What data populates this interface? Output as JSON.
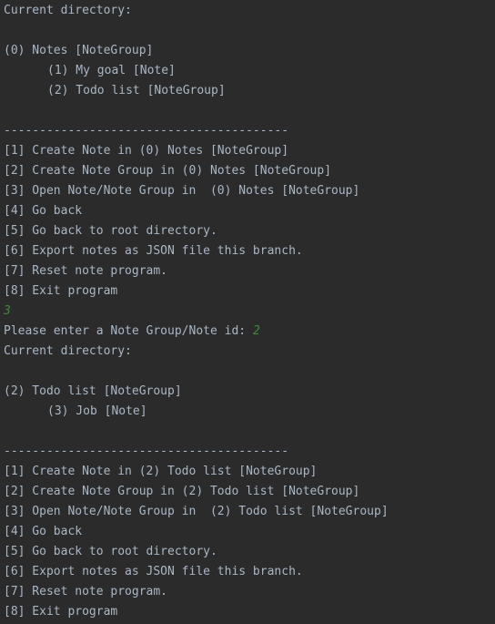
{
  "colors": {
    "background": "#2b2b2b",
    "text": "#a9b7c6",
    "user_input": "#3c8c3c"
  },
  "block1": {
    "header": "Current directory:",
    "dir": "(0) Notes [NoteGroup]",
    "children": [
      "(1) My goal [Note]",
      "(2) Todo list [NoteGroup]"
    ],
    "separator": "----------------------------------------",
    "menu": [
      "[1] Create Note in (0) Notes [NoteGroup]",
      "[2] Create Note Group in (0) Notes [NoteGroup]",
      "[3] Open Note/Note Group in  (0) Notes [NoteGroup]",
      "[4] Go back",
      "[5] Go back to root directory.",
      "[6] Export notes as JSON file this branch.",
      "[7] Reset note program.",
      "[8] Exit program"
    ],
    "input": "3"
  },
  "prompt": {
    "text": "Please enter a Note Group/Note id: ",
    "input": "2"
  },
  "block2": {
    "header": "Current directory:",
    "dir": "(2) Todo list [NoteGroup]",
    "children": [
      "(3) Job [Note]"
    ],
    "separator": "----------------------------------------",
    "menu": [
      "[1] Create Note in (2) Todo list [NoteGroup]",
      "[2] Create Note Group in (2) Todo list [NoteGroup]",
      "[3] Open Note/Note Group in  (2) Todo list [NoteGroup]",
      "[4] Go back",
      "[5] Go back to root directory.",
      "[6] Export notes as JSON file this branch.",
      "[7] Reset note program.",
      "[8] Exit program"
    ]
  }
}
